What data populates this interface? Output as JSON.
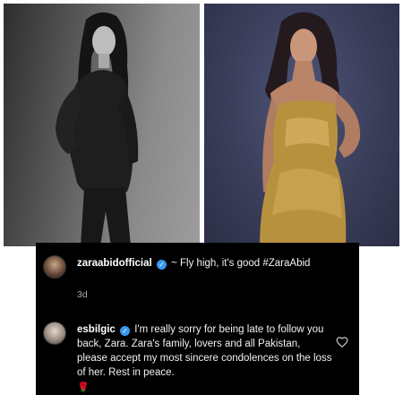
{
  "photos": {
    "left": {
      "icon": "woman-in-black-suit-photo"
    },
    "right": {
      "icon": "woman-in-gold-dress-photo"
    }
  },
  "comments": [
    {
      "username": "zaraabidofficial",
      "verified": true,
      "text": "~ Fly high, it's good #ZaraAbid",
      "time": "3d"
    },
    {
      "username": "esbilgic",
      "verified": true,
      "text": "I'm really sorry for being late to follow you back, Zara. Zara's family, lovers and all Pakistan, please accept my most sincere condolences on the loss of her.  Rest in peace.",
      "emoji": "🌹",
      "like_icon": "heart-outline-icon"
    }
  ],
  "colors": {
    "comment_bg": "#000000",
    "verified_badge": "#3897f0",
    "secondary_text": "#a8a8a8"
  }
}
